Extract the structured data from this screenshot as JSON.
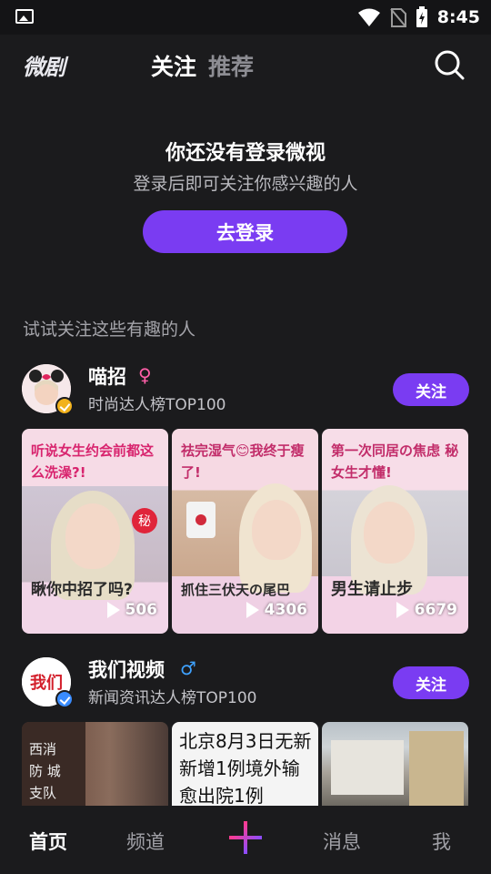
{
  "status_bar": {
    "time": "8:45"
  },
  "header": {
    "logo": "微剧",
    "tabs": [
      {
        "label": "关注",
        "active": true
      },
      {
        "label": "推荐",
        "active": false
      }
    ]
  },
  "login_prompt": {
    "title": "你还没有登录微视",
    "subtitle": "登录后即可关注你感兴趣的人",
    "button": "去登录"
  },
  "suggestions": {
    "title": "试试关注这些有趣的人",
    "creators": [
      {
        "name": "喵招",
        "gender": "♀",
        "desc": "时尚达人榜TOP100",
        "follow_label": "关注",
        "videos": [
          {
            "top_text": "听说女生约会前都这么洗澡?!",
            "bottom_text": "瞅你中招了吗?",
            "count": "506"
          },
          {
            "top_text": "祛完湿气😊我终于瘦了!",
            "bottom_text": "抓住三伏天の尾巴",
            "count": "4306"
          },
          {
            "top_text": "第一次同居の焦虑 秘女生才懂!",
            "bottom_text": "男生请止步",
            "count": "6679"
          }
        ]
      },
      {
        "name": "我们视频",
        "gender": "♂",
        "desc": "新闻资讯达人榜TOP100",
        "follow_label": "关注",
        "avatar_text": "我们",
        "videos": [
          {
            "text": "西消防 城支队"
          },
          {
            "text": "北京8月3日无新 新增1例境外输 愈出院1例"
          },
          {
            "text": ""
          }
        ]
      }
    ]
  },
  "bottom_nav": {
    "items": [
      {
        "label": "首页",
        "active": true
      },
      {
        "label": "频道"
      },
      {
        "label": "消息"
      },
      {
        "label": "我"
      }
    ]
  },
  "colors": {
    "accent": "#7a3cf2",
    "background": "#1b1b1d",
    "female": "#ff5fa8",
    "male": "#3fa2ff"
  }
}
